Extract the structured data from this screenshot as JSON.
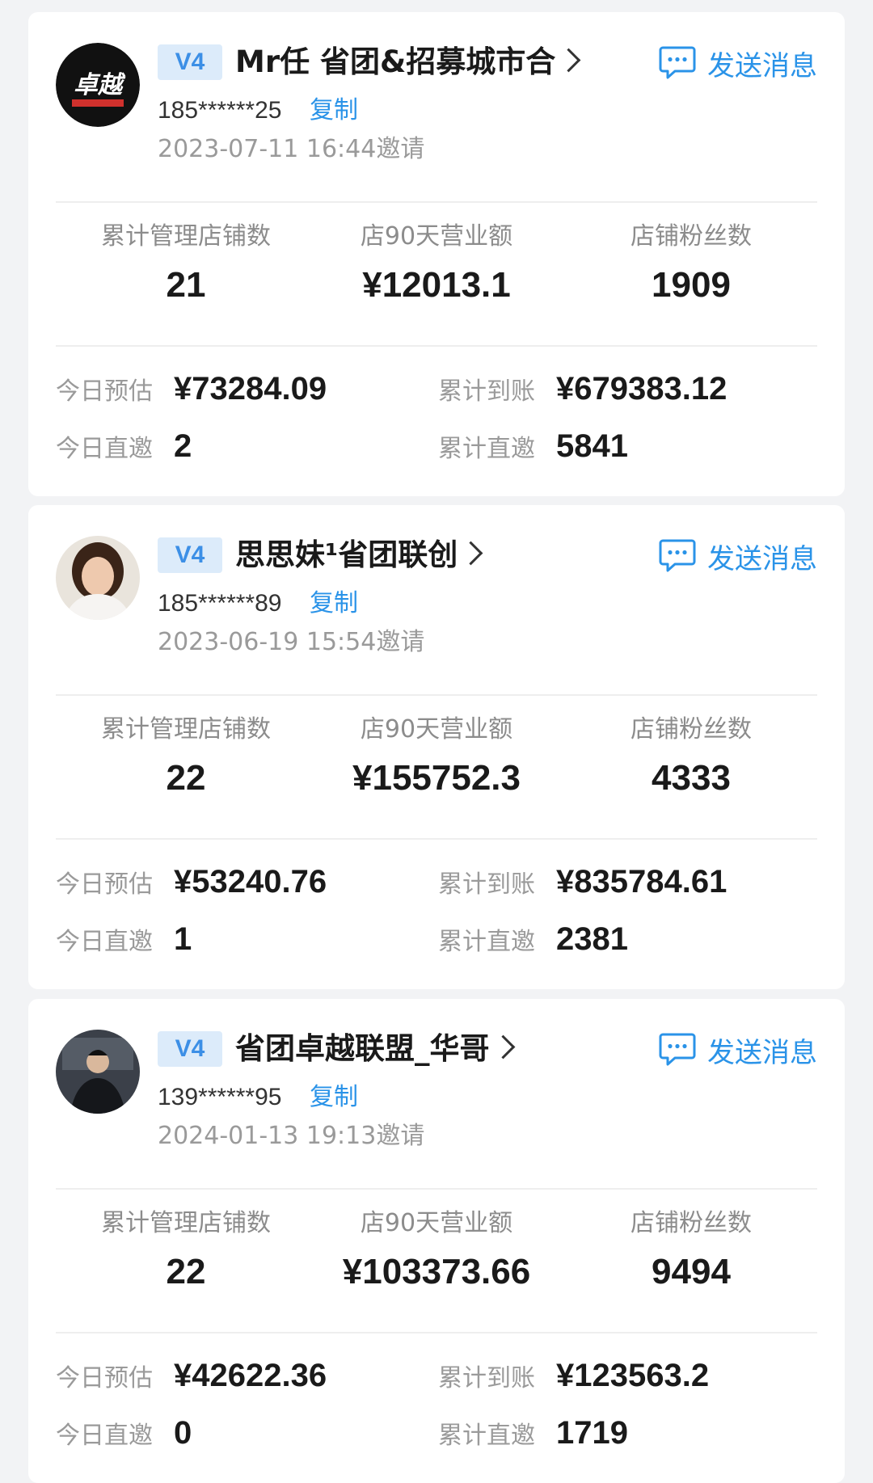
{
  "common": {
    "send_message": "发送消息",
    "copy": "复制",
    "stat_labels": [
      "累计管理店铺数",
      "店90天营业额",
      "店铺粉丝数"
    ],
    "today_estimate_label": "今日预估",
    "today_invite_label": "今日直邀",
    "total_received_label": "累计到账",
    "total_invite_label": "累计直邀"
  },
  "members": [
    {
      "level": "V4",
      "name": "Mr任 省团&招募城市合",
      "phone": "185******25",
      "invite_time": "2023-07-11 16:44邀请",
      "stores": "21",
      "revenue_90d": "¥12013.1",
      "fans": "1909",
      "today_estimate": "¥73284.09",
      "total_received": "¥679383.12",
      "today_invite": "2",
      "total_invite": "5841",
      "avatar_icon": "zhuoyue-logo-avatar",
      "avatar_logo_text": "卓越"
    },
    {
      "level": "V4",
      "name": "思思妹¹省团联创",
      "phone": "185******89",
      "invite_time": "2023-06-19 15:54邀请",
      "stores": "22",
      "revenue_90d": "¥155752.3",
      "fans": "4333",
      "today_estimate": "¥53240.76",
      "total_received": "¥835784.61",
      "today_invite": "1",
      "total_invite": "2381",
      "avatar_icon": "woman-portrait-avatar"
    },
    {
      "level": "V4",
      "name": "省团卓越联盟_华哥",
      "phone": "139******95",
      "invite_time": "2024-01-13 19:13邀请",
      "stores": "22",
      "revenue_90d": "¥103373.66",
      "fans": "9494",
      "today_estimate": "¥42622.36",
      "total_received": "¥123563.2",
      "today_invite": "0",
      "total_invite": "1719",
      "avatar_icon": "man-portrait-avatar"
    }
  ],
  "colors": {
    "accent_blue": "#2a93e8",
    "badge_bg": "#dcebfa",
    "badge_text": "#3c8fe6",
    "muted_text": "#9a9a9a",
    "page_bg": "#f2f3f5"
  }
}
